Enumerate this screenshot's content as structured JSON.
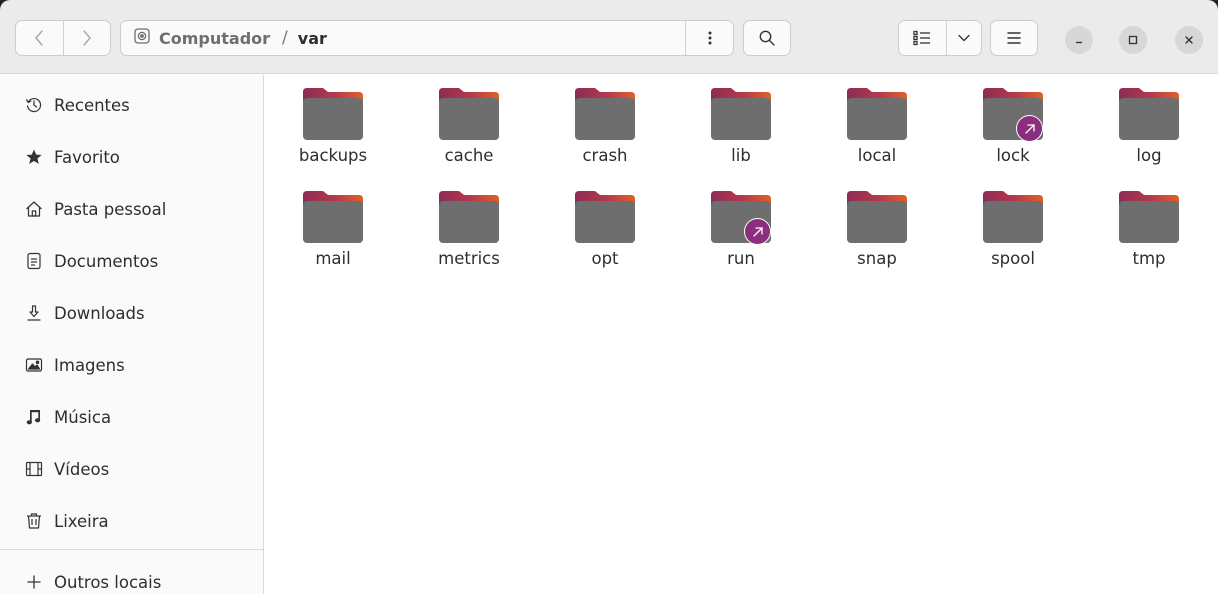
{
  "headerbar": {
    "path": {
      "root_label": "Computador",
      "separator": "/",
      "current_label": "var"
    },
    "path_menu_icon": "kebab-menu-icon",
    "search_icon": "search-icon",
    "view_icon": "list-view-icon",
    "view_dropdown_icon": "chevron-down-icon",
    "main_menu_icon": "hamburger-menu-icon"
  },
  "sidebar": {
    "items": [
      {
        "label": "Recentes",
        "icon": "recent-clock-icon"
      },
      {
        "label": "Favorito",
        "icon": "star-icon"
      },
      {
        "label": "Pasta pessoal",
        "icon": "home-icon"
      },
      {
        "label": "Documentos",
        "icon": "document-icon"
      },
      {
        "label": "Downloads",
        "icon": "download-icon"
      },
      {
        "label": "Imagens",
        "icon": "image-icon"
      },
      {
        "label": "Música",
        "icon": "music-icon"
      },
      {
        "label": "Vídeos",
        "icon": "video-icon"
      },
      {
        "label": "Lixeira",
        "icon": "trash-icon"
      }
    ],
    "other_locations": {
      "label": "Outros locais",
      "icon": "plus-icon"
    }
  },
  "files": [
    {
      "name": "backups",
      "symlink": false
    },
    {
      "name": "cache",
      "symlink": false
    },
    {
      "name": "crash",
      "symlink": false
    },
    {
      "name": "lib",
      "symlink": false
    },
    {
      "name": "local",
      "symlink": false
    },
    {
      "name": "lock",
      "symlink": true
    },
    {
      "name": "log",
      "symlink": false
    },
    {
      "name": "mail",
      "symlink": false
    },
    {
      "name": "metrics",
      "symlink": false
    },
    {
      "name": "opt",
      "symlink": false
    },
    {
      "name": "run",
      "symlink": true
    },
    {
      "name": "snap",
      "symlink": false
    },
    {
      "name": "spool",
      "symlink": false
    },
    {
      "name": "tmp",
      "symlink": false
    }
  ],
  "colors": {
    "folder_body": "#6e6e6e",
    "folder_tab_left": "#8d2c58",
    "folder_tab_right": "#e0602a",
    "symlink_badge": "#8a2e7d"
  }
}
